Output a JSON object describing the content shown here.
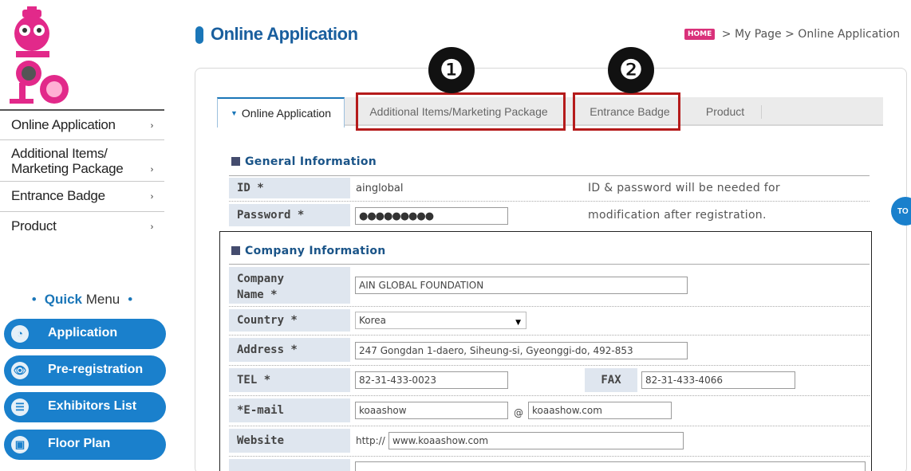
{
  "sidebar": {
    "items": [
      {
        "label": "Online Application"
      },
      {
        "label_line1": "Additional Items/",
        "label_line2": "Marketing Package"
      },
      {
        "label": "Entrance Badge"
      },
      {
        "label": "Product"
      }
    ],
    "arrow": "›"
  },
  "quick_menu": {
    "dot": "•",
    "title_bold": "Quick",
    "title_rest": " Menu",
    "buttons": [
      {
        "label": "Application",
        "icon": "refresh-icon",
        "glyph": "◔"
      },
      {
        "label": "Pre-registration",
        "icon": "eye-icon",
        "glyph": "👁"
      },
      {
        "label": "Exhibitors List",
        "icon": "list-icon",
        "glyph": "☰"
      },
      {
        "label": "Floor Plan",
        "icon": "save-icon",
        "glyph": "▣"
      }
    ]
  },
  "header": {
    "title": "Online Application",
    "breadcrumb": {
      "home_badge": "HOME",
      "sep": ">",
      "path1": "My Page",
      "path2": "Online Application"
    }
  },
  "tabs": [
    {
      "label": "Online Application",
      "active": true
    },
    {
      "label": "Additional Items/Marketing Package",
      "active": false
    },
    {
      "label": "Entrance Badge",
      "active": false
    },
    {
      "label": "Product",
      "active": false
    }
  ],
  "annotations": [
    "❶",
    "❷"
  ],
  "general": {
    "title": "General Information",
    "id_label": "ID *",
    "id_value": "ainglobal",
    "password_label": "Password *",
    "password_value": "●●●●●●●●●",
    "note1": "ID & password will be needed for",
    "note2": "modification after registration."
  },
  "company": {
    "title": "Company Information",
    "name_label1": "Company",
    "name_label2": "Name *",
    "name_value": "AIN GLOBAL FOUNDATION",
    "country_label": "Country *",
    "country_value": "Korea",
    "address_label": "Address *",
    "address_value": "247 Gongdan 1-daero, Siheung-si, Gyeonggi-do, 492-853",
    "tel_label": "TEL *",
    "tel_value": "82-31-433-0023",
    "fax_label": "FAX",
    "fax_value": "82-31-433-4066",
    "email_label": "*E-mail",
    "email_user": "koaashow",
    "email_at": "@",
    "email_domain": "koaashow.com",
    "website_label": "Website",
    "website_prefix": "http://",
    "website_value": "www.koaashow.com"
  },
  "top_button": "TO",
  "colors": {
    "accent": "#1a76b8",
    "button": "#1a80cc",
    "annotation_red": "#b51b1b",
    "home_badge": "#d9317a"
  }
}
